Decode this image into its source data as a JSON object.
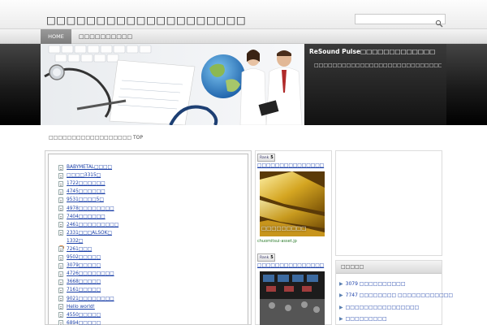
{
  "header": {
    "site_title": "□□□□□□□□□□□□□□□□□□□□",
    "search_placeholder": "",
    "search_icon": "magnifier-icon"
  },
  "nav": {
    "home_label": "HOME",
    "category_label": "□□□□□□□□□□"
  },
  "banner": {
    "title": "ReSound Pulse□□□□□□□□□□□□□",
    "description": "□□□□□□□□□□□□□□□□□□□□□□□□□□□□□□□□□□□□"
  },
  "breadcrumb": "□□□□□□□□□□□□□□□□□□ TOP",
  "posts": [
    {
      "label": "BABYMETAL□□□□",
      "icon": "doc-icon"
    },
    {
      "label": "□□□□3315□",
      "icon": "doc-icon"
    },
    {
      "label": "1722□□□□□□",
      "icon": "doc-icon"
    },
    {
      "label": "4745□□□□□□",
      "icon": "doc-icon"
    },
    {
      "label": "9531□□□□5□",
      "icon": "doc-icon"
    },
    {
      "label": "4978□□□□□□□□",
      "icon": "doc-icon"
    },
    {
      "label": "7404□□□□□□",
      "icon": "doc-icon"
    },
    {
      "label": "2461□□□□□□□□□",
      "icon": "doc-icon"
    },
    {
      "label": "2331□□□ALSOK□",
      "icon": "doc-icon"
    },
    {
      "label": "1332□",
      "icon": "eye-icon"
    },
    {
      "label": "7261□□□",
      "icon": "doc-icon"
    },
    {
      "label": "9502□□□□□",
      "icon": "doc-icon"
    },
    {
      "label": "3079□□□□□",
      "icon": "doc-icon"
    },
    {
      "label": "4726□□□□□□□□",
      "icon": "doc-icon"
    },
    {
      "label": "3668□□□□□",
      "icon": "doc-icon"
    },
    {
      "label": "7161□□□□□",
      "icon": "doc-icon"
    },
    {
      "label": "9021□□□□□□□□",
      "icon": "doc-icon"
    },
    {
      "label": "Hello world!",
      "icon": "doc-icon"
    },
    {
      "label": "4550□□□□□",
      "icon": "doc-icon"
    },
    {
      "label": "6894□□□□□",
      "icon": "doc-icon"
    }
  ],
  "mid": {
    "rank1": {
      "label": "Rank",
      "num": "5"
    },
    "link1": "□□□□□□□□□□□□□□□",
    "ad1_overlay": "□□□□□□□□□",
    "caption1": "chuomitsui-asset.jp",
    "rank2": {
      "label": "Rank",
      "num": "5"
    },
    "link2": "□□□□□□□□□□□□□□□"
  },
  "sidebar": {
    "widget_title": "□□□□□",
    "items": [
      {
        "label": "3079 □□□□□□□□□□"
      },
      {
        "label": "7747 □□□□□□□□ □□□□□□□□□□□□"
      },
      {
        "label": "□□□□□□□□□□□□□□□□"
      },
      {
        "label": "□□□□□□□□□"
      }
    ]
  }
}
